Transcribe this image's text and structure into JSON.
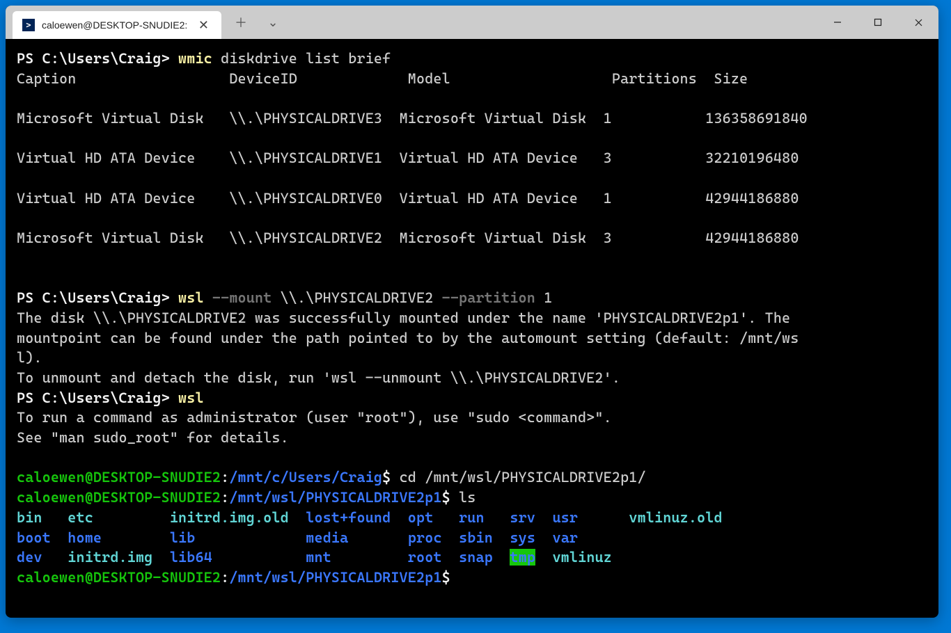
{
  "tab": {
    "title": "caloewen@DESKTOP-SNUDIE2:"
  },
  "ps_prompt": "PS C:\\Users\\Craig>",
  "cmd1": {
    "exe": "wmic",
    "args": "diskdrive list brief"
  },
  "table": {
    "headers": {
      "caption": "Caption",
      "deviceid": "DeviceID",
      "model": "Model",
      "partitions": "Partitions",
      "size": "Size"
    },
    "rows": [
      {
        "caption": "Microsoft Virtual Disk",
        "deviceid": "\\\\.\\PHYSICALDRIVE3",
        "model": "Microsoft Virtual Disk",
        "partitions": "1",
        "size": "136358691840"
      },
      {
        "caption": "Virtual HD ATA Device",
        "deviceid": "\\\\.\\PHYSICALDRIVE1",
        "model": "Virtual HD ATA Device",
        "partitions": "3",
        "size": "32210196480"
      },
      {
        "caption": "Virtual HD ATA Device",
        "deviceid": "\\\\.\\PHYSICALDRIVE0",
        "model": "Virtual HD ATA Device",
        "partitions": "1",
        "size": "42944186880"
      },
      {
        "caption": "Microsoft Virtual Disk",
        "deviceid": "\\\\.\\PHYSICALDRIVE2",
        "model": "Microsoft Virtual Disk",
        "partitions": "3",
        "size": "42944186880"
      }
    ]
  },
  "cmd2": {
    "exe": "wsl",
    "flag1": "--mount",
    "arg1": "\\\\.\\PHYSICALDRIVE2",
    "flag2": "--partition",
    "arg2": "1"
  },
  "mount_msg": "The disk \\\\.\\PHYSICALDRIVE2 was successfully mounted under the name 'PHYSICALDRIVE2p1'. The\nmountpoint can be found under the path pointed to by the automount setting (default: /mnt/ws\nl).\nTo unmount and detach the disk, run 'wsl --unmount \\\\.\\PHYSICALDRIVE2'.",
  "cmd3": {
    "exe": "wsl"
  },
  "sudo_msg": "To run a command as administrator (user \"root\"), use \"sudo <command>\".\nSee \"man sudo_root\" for details.",
  "linux": {
    "user_host": "caloewen@DESKTOP-SNUDIE2",
    "path1": "/mnt/c/Users/Craig",
    "path2": "/mnt/wsl/PHYSICALDRIVE2p1",
    "dollar": "$",
    "colon": ":",
    "cmd_cd": "cd /mnt/wsl/PHYSICALDRIVE2p1/",
    "cmd_ls": "ls"
  },
  "ls": {
    "row1": {
      "c0": "bin",
      "c1": "etc",
      "c2": "initrd.img.old",
      "c3": "lost+found",
      "c4": "opt",
      "c5": "run",
      "c6": "srv",
      "c7": "usr",
      "c8": "vmlinuz.old"
    },
    "row2": {
      "c0": "boot",
      "c1": "home",
      "c2": "lib",
      "c3": "media",
      "c4": "proc",
      "c5": "sbin",
      "c6": "sys",
      "c7": "var",
      "c8": ""
    },
    "row3": {
      "c0": "dev",
      "c1": "initrd.img",
      "c2": "lib64",
      "c3": "mnt",
      "c4": "root",
      "c5": "snap",
      "c6": "tmp",
      "c7": "vmlinuz",
      "c8": ""
    }
  }
}
